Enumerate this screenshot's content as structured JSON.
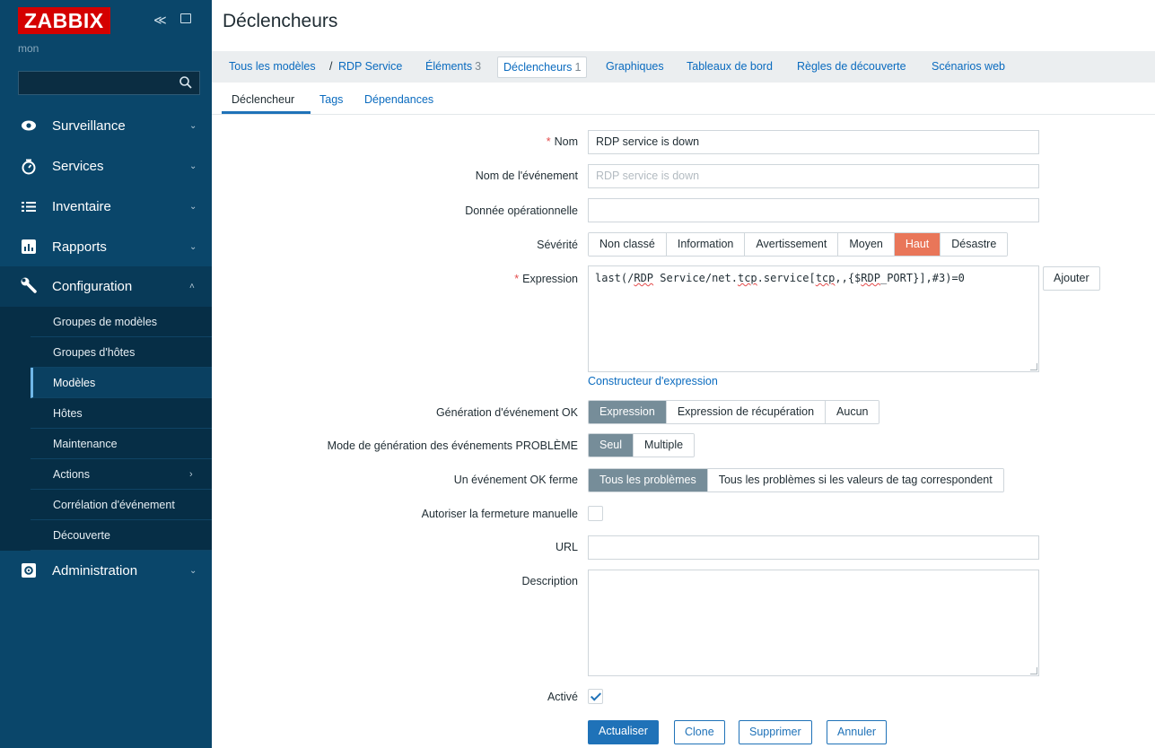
{
  "sidebar": {
    "logo": "ZABBIX",
    "user": "mon",
    "menu": [
      {
        "label": "Surveillance",
        "icon": "eye-icon"
      },
      {
        "label": "Services",
        "icon": "stopwatch-icon"
      },
      {
        "label": "Inventaire",
        "icon": "list-icon"
      },
      {
        "label": "Rapports",
        "icon": "bar-chart-icon"
      },
      {
        "label": "Configuration",
        "icon": "wrench-icon"
      },
      {
        "label": "Administration",
        "icon": "gear-icon"
      }
    ],
    "submenu": [
      "Groupes de modèles",
      "Groupes d'hôtes",
      "Modèles",
      "Hôtes",
      "Maintenance",
      "Actions",
      "Corrélation d'événement",
      "Découverte"
    ]
  },
  "page": {
    "title": "Déclencheurs"
  },
  "topnav": {
    "all_templates": "Tous les modèles",
    "separator": "/",
    "template": "RDP Service",
    "items": "Éléments",
    "items_count": "3",
    "triggers": "Déclencheurs",
    "triggers_count": "1",
    "graphs": "Graphiques",
    "dashboards": "Tableaux de bord",
    "discovery": "Règles de découverte",
    "web": "Scénarios web"
  },
  "tabs": [
    "Déclencheur",
    "Tags",
    "Dépendances"
  ],
  "form": {
    "name_label": "Nom",
    "name_value": "RDP service is down",
    "event_name_label": "Nom de l'événement",
    "event_name_placeholder": "RDP service is down",
    "opdata_label": "Donnée opérationnelle",
    "severity_label": "Sévérité",
    "severities": [
      "Non classé",
      "Information",
      "Avertissement",
      "Moyen",
      "Haut",
      "Désastre"
    ],
    "severity_selected": "Haut",
    "expression_label": "Expression",
    "expression_parts": [
      "last(/",
      "RDP",
      " Service/net.",
      "tcp",
      ".service[",
      "tcp",
      ",,{$",
      "RDP",
      "_PORT}],#3)=0"
    ],
    "add_button": "Ajouter",
    "expression_builder": "Constructeur d'expression",
    "ok_event_label": "Génération d'événement OK",
    "ok_event_options": [
      "Expression",
      "Expression de récupération",
      "Aucun"
    ],
    "problem_mode_label": "Mode de génération des événements PROBLÈME",
    "problem_mode_options": [
      "Seul",
      "Multiple"
    ],
    "ok_closes_label": "Un événement OK ferme",
    "ok_closes_options": [
      "Tous les problèmes",
      "Tous les problèmes si les valeurs de tag correspondent"
    ],
    "manual_close_label": "Autoriser la fermeture manuelle",
    "url_label": "URL",
    "description_label": "Description",
    "enabled_label": "Activé",
    "buttons": {
      "update": "Actualiser",
      "clone": "Clone",
      "delete": "Supprimer",
      "cancel": "Annuler"
    }
  },
  "colors": {
    "sidebar": "#0a466a",
    "logo": "#d40000",
    "accent": "#1f72b8",
    "severity_high": "#e97659"
  }
}
